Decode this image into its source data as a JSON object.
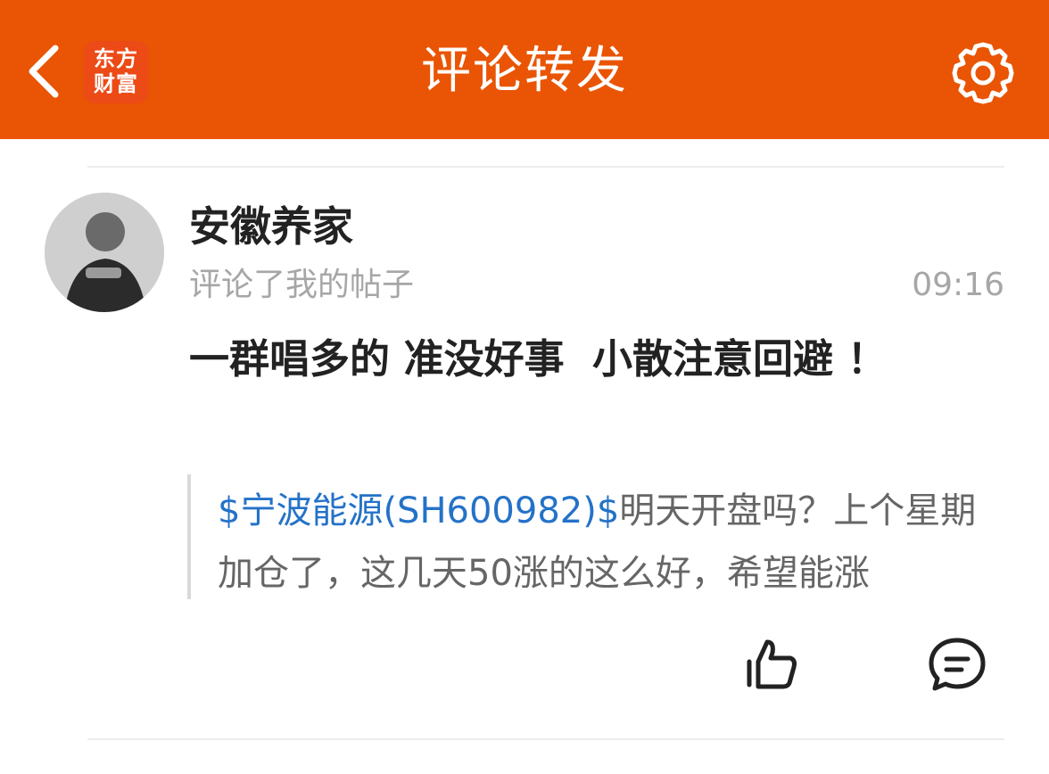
{
  "header": {
    "title": "评论转发",
    "logo_line1": "东方",
    "logo_line2": "财富",
    "back_icon": "chevron-left-icon",
    "settings_icon": "gear-icon"
  },
  "colors": {
    "brand": "#E95504",
    "link": "#2472C8"
  },
  "item": {
    "username": "安徽养家",
    "action": "评论了我的帖子",
    "time": "09:16",
    "comment": "一群唱多的 准没好事  小散注意回避 ！",
    "quote": {
      "stock_tag": "$宁波能源(SH600982)$",
      "text": "明天开盘吗？上个星期加仓了，这几天50涨的这么好，希望能涨"
    },
    "like_icon": "thumbs-up-icon",
    "reply_icon": "comment-icon"
  }
}
